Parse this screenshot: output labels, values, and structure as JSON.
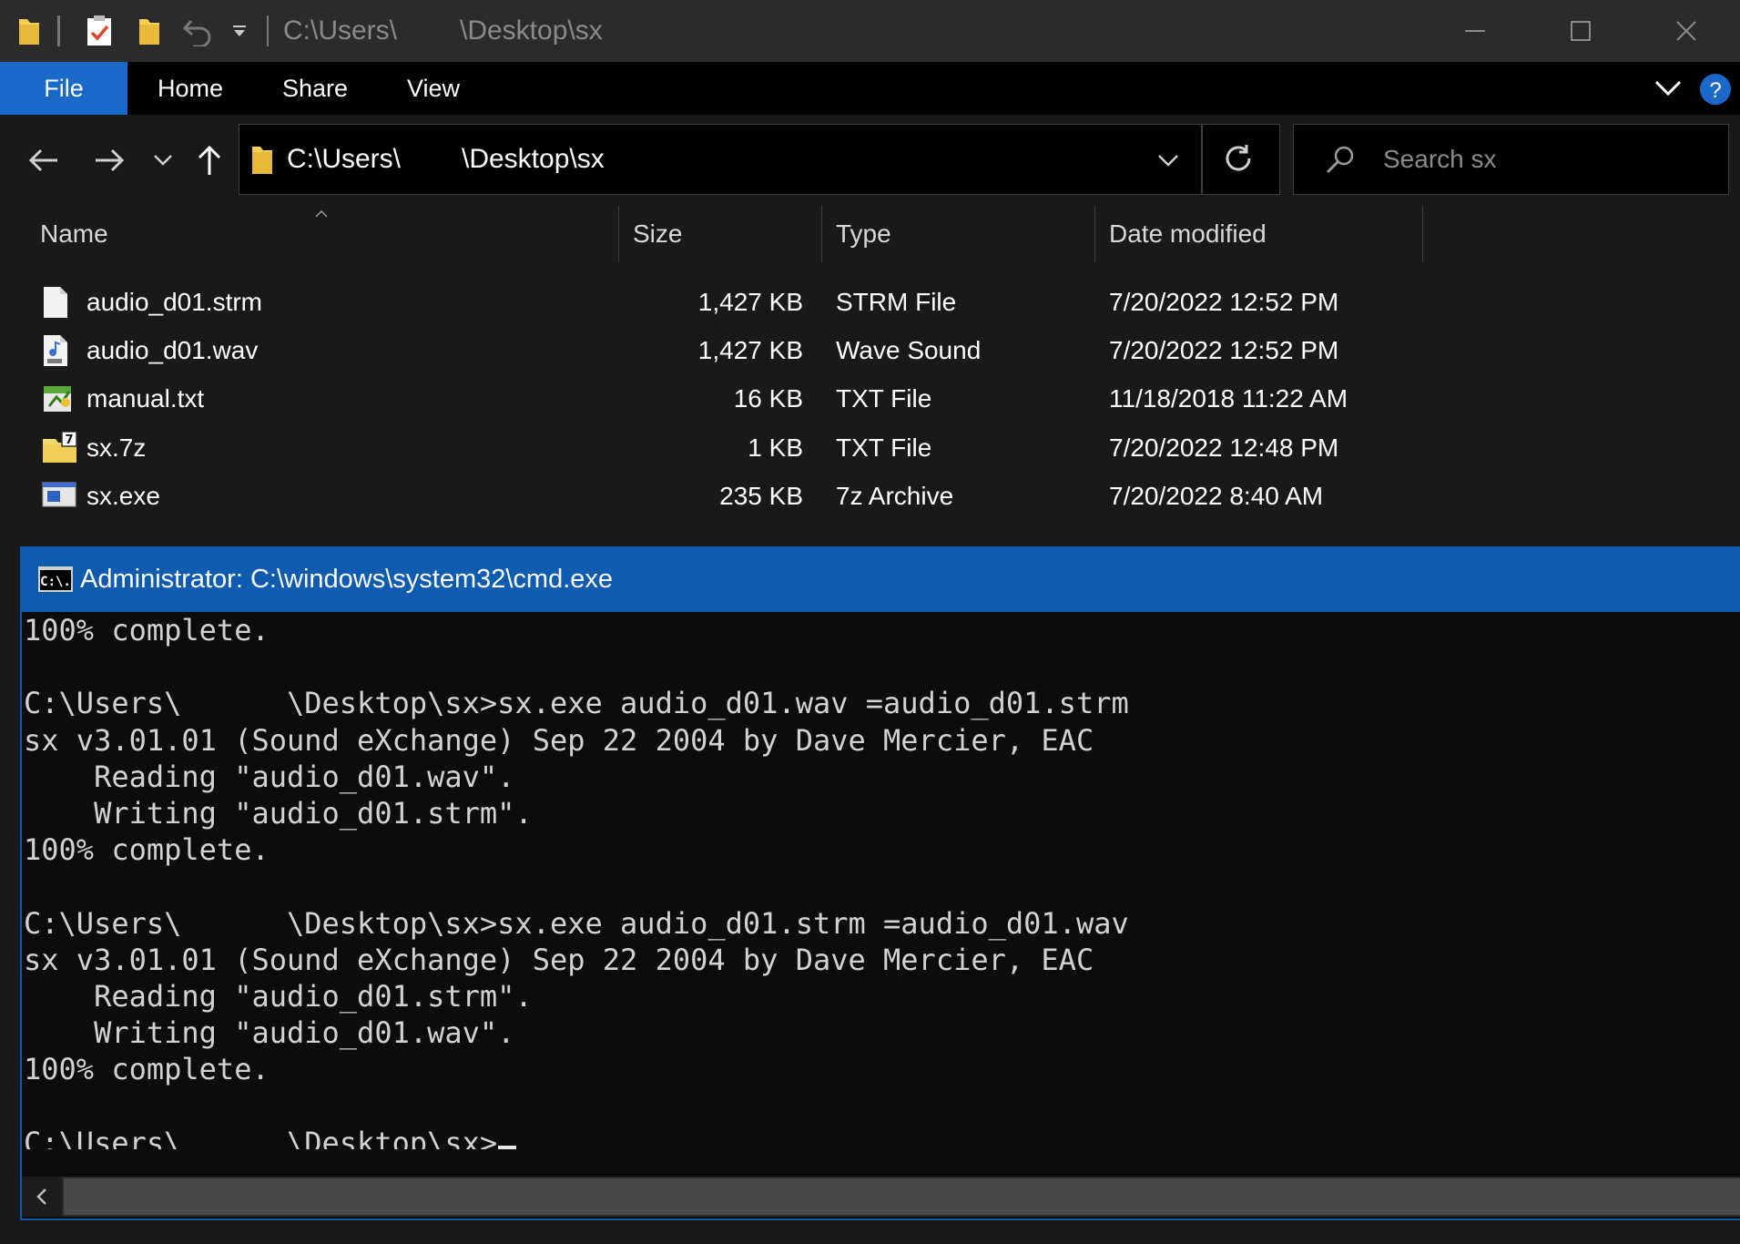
{
  "window": {
    "title_path_start": "C:\\Users\\",
    "title_path_end": "\\Desktop\\sx"
  },
  "ribbon": {
    "tabs": [
      "File",
      "Home",
      "Share",
      "View"
    ]
  },
  "address_bar": {
    "path_start": "C:\\Users\\",
    "path_end": "\\Desktop\\sx"
  },
  "search": {
    "placeholder": "Search sx"
  },
  "file_list": {
    "columns": {
      "name": "Name",
      "size": "Size",
      "type": "Type",
      "date": "Date modified"
    },
    "rows": [
      {
        "name": "audio_d01.strm",
        "size": "1,427 KB",
        "type": "STRM File",
        "date": "7/20/2022 12:52 PM",
        "icon": "blank-file-icon"
      },
      {
        "name": "audio_d01.wav",
        "size": "1,427 KB",
        "type": "Wave Sound",
        "date": "7/20/2022 12:52 PM",
        "icon": "wav-file-icon"
      },
      {
        "name": "manual.txt",
        "size": "16 KB",
        "type": "TXT File",
        "date": "11/18/2018 11:22 AM",
        "icon": "text-file-icon"
      },
      {
        "name": "sx.7z",
        "size": "1 KB",
        "type": "TXT File",
        "date": "7/20/2022 12:48 PM",
        "icon": "archive-file-icon"
      },
      {
        "name": "sx.exe",
        "size": "235 KB",
        "type": "7z Archive",
        "date": "7/20/2022 8:40 AM",
        "icon": "exe-file-icon"
      }
    ]
  },
  "cmd": {
    "title": "Administrator: C:\\windows\\system32\\cmd.exe",
    "icon_label": "C:\\.",
    "lines": [
      "100% complete.",
      "",
      "C:\\Users\\      \\Desktop\\sx>sx.exe audio_d01.wav =audio_d01.strm",
      "sx v3.01.01 (Sound eXchange) Sep 22 2004 by Dave Mercier, EAC",
      "    Reading \"audio_d01.wav\".",
      "    Writing \"audio_d01.strm\".",
      "100% complete.",
      "",
      "C:\\Users\\      \\Desktop\\sx>sx.exe audio_d01.strm =audio_d01.wav",
      "sx v3.01.01 (Sound eXchange) Sep 22 2004 by Dave Mercier, EAC",
      "    Reading \"audio_d01.strm\".",
      "    Writing \"audio_d01.wav\".",
      "100% complete.",
      ""
    ],
    "prompt": "C:\\Users\\      \\Desktop\\sx>"
  },
  "colors": {
    "accent_blue": "#1a68c7",
    "cmd_title_blue": "#0e5bb0",
    "folder_yellow": "#f6cf57",
    "help_blue": "#1a68c7"
  }
}
